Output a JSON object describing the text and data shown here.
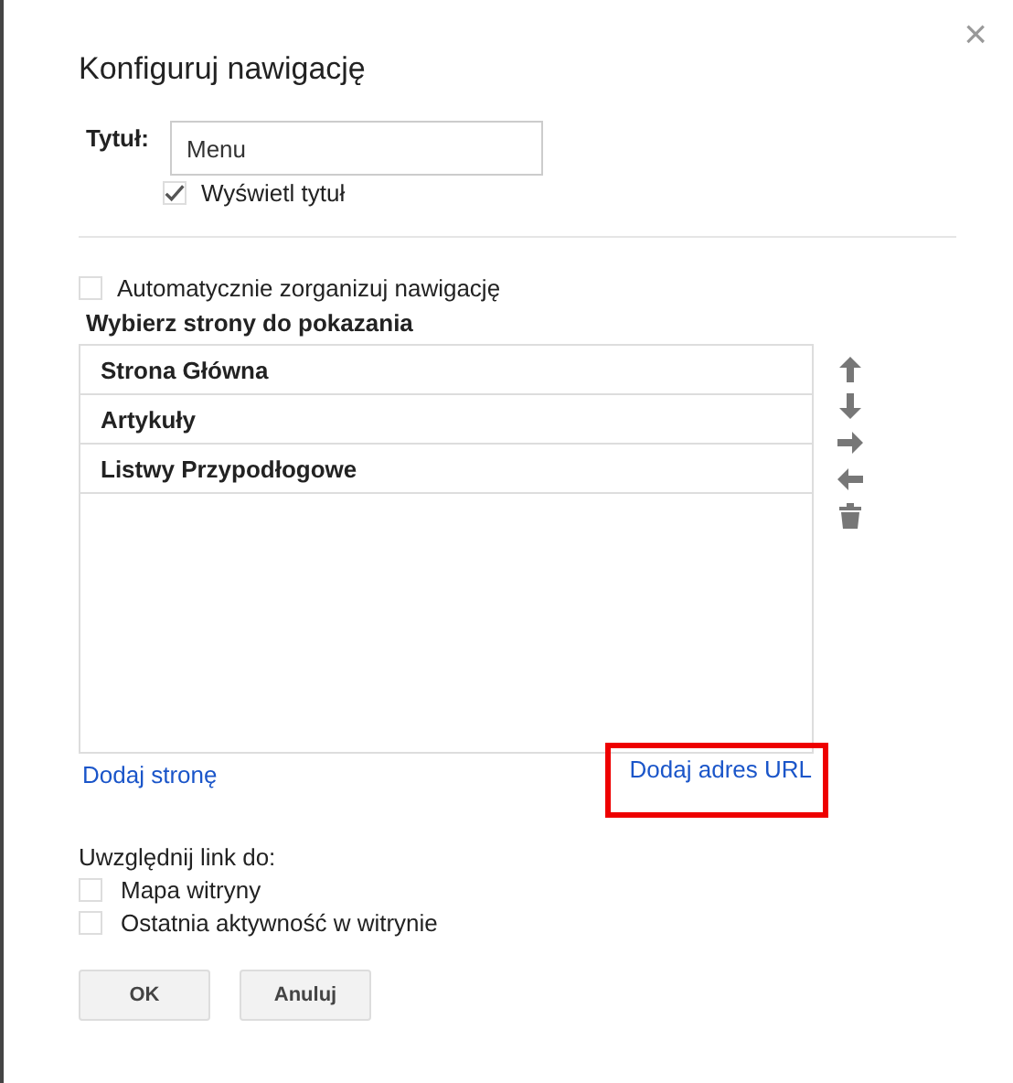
{
  "dialog": {
    "title": "Konfiguruj nawigację",
    "close": "×"
  },
  "title_field": {
    "label": "Tytuł:",
    "value": "Menu"
  },
  "show_title": {
    "label": "Wyświetl tytuł",
    "checked": true
  },
  "auto_organize": {
    "label": "Automatycznie zorganizuj nawigację",
    "checked": false
  },
  "pages": {
    "heading": "Wybierz strony do pokazania",
    "items": [
      {
        "label": "Strona Główna",
        "selected": false
      },
      {
        "label": "Artykuły",
        "selected": false
      },
      {
        "label": "Listwy Przypodłogowe",
        "selected": false
      }
    ],
    "tools": [
      {
        "kind": "up"
      },
      {
        "kind": "down"
      },
      {
        "kind": "right"
      },
      {
        "kind": "left"
      },
      {
        "kind": "trash"
      }
    ]
  },
  "links": [
    {
      "label": "Dodaj stronę",
      "highlighted": false
    },
    {
      "label": "Dodaj adres URL",
      "highlighted": true
    }
  ],
  "include": {
    "heading": "Uwzględnij link do:",
    "options": [
      {
        "label": "Mapa witryny",
        "checked": false
      },
      {
        "label": "Ostatnia aktywność w witrynie",
        "checked": false
      }
    ]
  },
  "buttons": [
    "OK",
    "Anuluj"
  ]
}
